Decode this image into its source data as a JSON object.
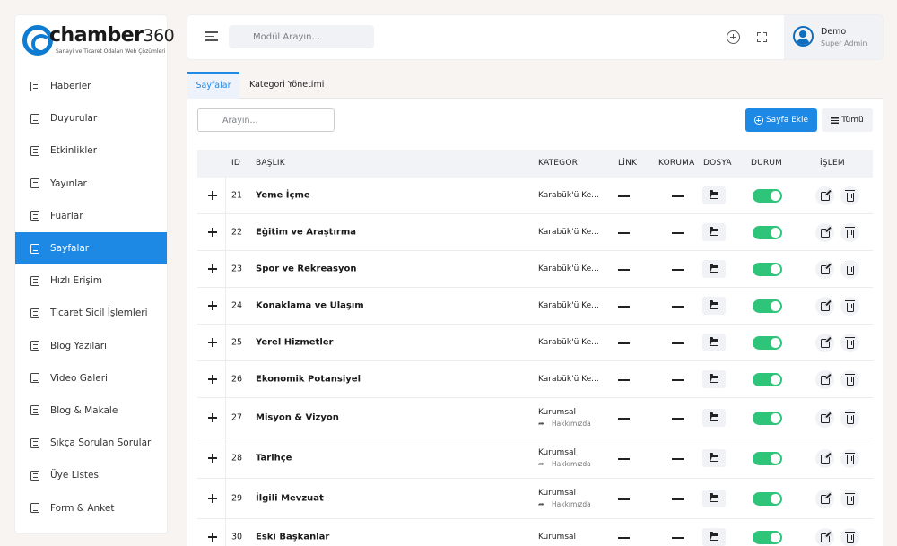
{
  "brand": {
    "name": "chamber",
    "num": "360",
    "tagline": "Sanayi ve Ticaret Odaları Web Çözümleri"
  },
  "sidebar": {
    "items": [
      {
        "label": "Haberler",
        "icon": "newspaper-icon",
        "active": false
      },
      {
        "label": "Duyurular",
        "icon": "megaphone-icon",
        "active": false
      },
      {
        "label": "Etkinlikler",
        "icon": "calendar-icon",
        "active": false
      },
      {
        "label": "Yayınlar",
        "icon": "book-icon",
        "active": false
      },
      {
        "label": "Fuarlar",
        "icon": "building-icon",
        "active": false
      },
      {
        "label": "Sayfalar",
        "icon": "page-icon",
        "active": true
      },
      {
        "label": "Hızlı Erişim",
        "icon": "list-icon",
        "active": false
      },
      {
        "label": "Ticaret Sicil İşlemleri",
        "icon": "registry-icon",
        "active": false
      },
      {
        "label": "Blog Yazıları",
        "icon": "pen-icon",
        "active": false
      },
      {
        "label": "Video Galeri",
        "icon": "video-icon",
        "active": false
      },
      {
        "label": "Blog & Makale",
        "icon": "quill-icon",
        "active": false
      },
      {
        "label": "Sıkça Sorulan Sorular",
        "icon": "question-icon",
        "active": false
      },
      {
        "label": "Üye Listesi",
        "icon": "users-icon",
        "active": false
      },
      {
        "label": "Form & Anket",
        "icon": "clipboard-icon",
        "active": false
      }
    ]
  },
  "header": {
    "search_placeholder": "Modül Arayın...",
    "user_name": "Demo",
    "user_role": "Super Admin"
  },
  "tabs": [
    {
      "label": "Sayfalar",
      "active": true
    },
    {
      "label": "Kategori Yönetimi",
      "active": false
    }
  ],
  "toolbar": {
    "search_placeholder": "Arayın...",
    "add_label": "Sayfa Ekle",
    "all_label": "Tümü"
  },
  "table": {
    "columns": {
      "id": "ID",
      "title": "BAŞLIK",
      "category": "KATEGORİ",
      "link": "LİNK",
      "protection": "KORUMA",
      "file": "DOSYA",
      "status": "DURUM",
      "action": "İŞLEM"
    },
    "rows": [
      {
        "id": "21",
        "title": "Yeme İçme",
        "category": "Karabük'ü Ke...",
        "subcategory": "",
        "link": "—",
        "protection": "—",
        "status_on": true
      },
      {
        "id": "22",
        "title": "Eğitim ve Araştırma",
        "category": "Karabük'ü Ke...",
        "subcategory": "",
        "link": "—",
        "protection": "—",
        "status_on": true
      },
      {
        "id": "23",
        "title": "Spor ve Rekreasyon",
        "category": "Karabük'ü Ke...",
        "subcategory": "",
        "link": "—",
        "protection": "—",
        "status_on": true
      },
      {
        "id": "24",
        "title": "Konaklama ve Ulaşım",
        "category": "Karabük'ü Ke...",
        "subcategory": "",
        "link": "—",
        "protection": "—",
        "status_on": true
      },
      {
        "id": "25",
        "title": "Yerel Hizmetler",
        "category": "Karabük'ü Ke...",
        "subcategory": "",
        "link": "—",
        "protection": "—",
        "status_on": true
      },
      {
        "id": "26",
        "title": "Ekonomik Potansiyel",
        "category": "Karabük'ü Ke...",
        "subcategory": "",
        "link": "—",
        "protection": "—",
        "status_on": true
      },
      {
        "id": "27",
        "title": "Misyon & Vizyon",
        "category": "Kurumsal",
        "subcategory": "Hakkımızda",
        "link": "—",
        "protection": "—",
        "status_on": true
      },
      {
        "id": "28",
        "title": "Tarihçe",
        "category": "Kurumsal",
        "subcategory": "Hakkımızda",
        "link": "—",
        "protection": "—",
        "status_on": true
      },
      {
        "id": "29",
        "title": "İlgili Mevzuat",
        "category": "Kurumsal",
        "subcategory": "Hakkımızda",
        "link": "—",
        "protection": "—",
        "status_on": true
      },
      {
        "id": "30",
        "title": "Eski Başkanlar",
        "category": "Kurumsal",
        "subcategory": "",
        "link": "—",
        "protection": "—",
        "status_on": true
      }
    ]
  },
  "colors": {
    "accent": "#1e88e5",
    "toggle_on": "#2ec47a",
    "background": "#f7f4f1"
  }
}
